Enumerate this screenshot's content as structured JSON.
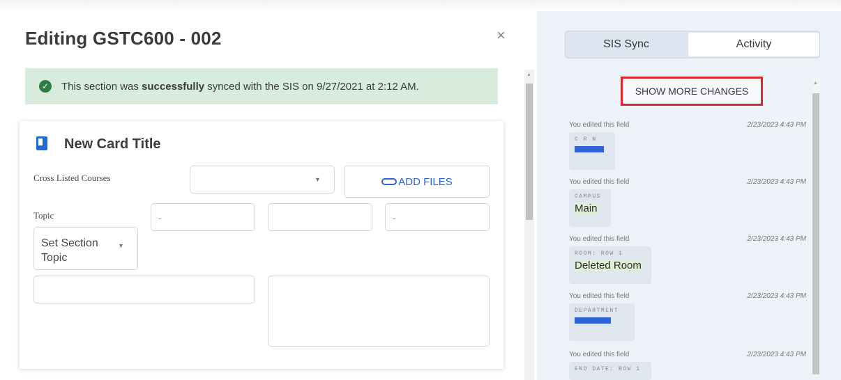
{
  "modal": {
    "title": "Editing GSTC600 - 002",
    "close_glyph": "×",
    "banner": {
      "pre": "This section was ",
      "bold": "successfully",
      "post": " synced with the SIS on 9/27/2021 at 2:12 AM.",
      "icon": "check-circle-icon",
      "color": "#2e7d45"
    },
    "card": {
      "title": "New Card Title",
      "cross_listed_label": "Cross Listed Courses",
      "add_files_label": "ADD FILES",
      "topic_label": "Topic",
      "topic_select_value": "Set Section Topic",
      "dash_fields": [
        "-",
        "",
        "-"
      ]
    }
  },
  "panel": {
    "tabs": [
      {
        "label": "SIS Sync",
        "active": false
      },
      {
        "label": "Activity",
        "active": true
      }
    ],
    "show_more_label": "SHOW MORE CHANGES",
    "highlight_color": "#d82a2a",
    "entries": [
      {
        "action": "You edited this field",
        "timestamp": "2/23/2023 4:43 PM",
        "field": "C R N",
        "value": "",
        "redacted": true
      },
      {
        "action": "You edited this field",
        "timestamp": "2/23/2023 4:43 PM",
        "field": "CAMPUS",
        "value": "Main",
        "redacted": false
      },
      {
        "action": "You edited this field",
        "timestamp": "2/23/2023 4:43 PM",
        "field": "ROOM: ROW 1",
        "value": "Deleted Room",
        "redacted": false
      },
      {
        "action": "You edited this field",
        "timestamp": "2/23/2023 4:43 PM",
        "field": "DEPARTMENT",
        "value": "",
        "redacted": true
      },
      {
        "action": "You edited this field",
        "timestamp": "2/23/2023 4:43 PM",
        "field": "END DATE: ROW 1",
        "value": "",
        "redacted": false
      }
    ]
  }
}
